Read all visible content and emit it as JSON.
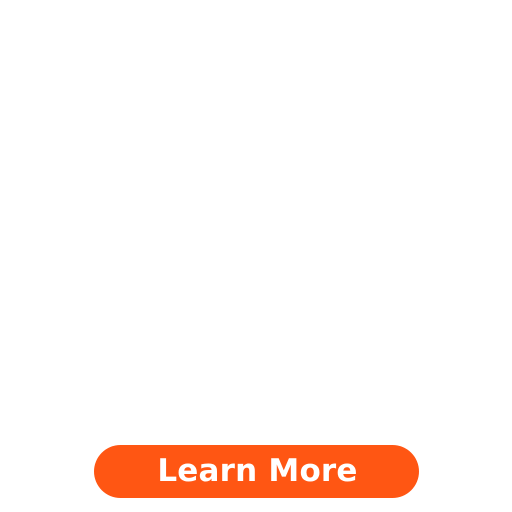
{
  "cta": {
    "label": "Learn More",
    "background_color": "#ff5613",
    "text_color": "#ffffff"
  },
  "page": {
    "background_color": "#ffffff"
  }
}
